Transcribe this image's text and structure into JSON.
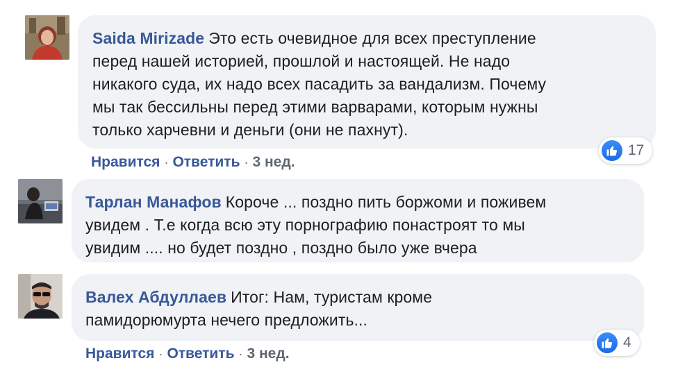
{
  "comments": [
    {
      "author": "Saida Mirizade",
      "lines": [
        "Это есть очевидное для всех преступление",
        "перед нашей историей, прошлой и настоящей. Не надо",
        "никакого суда, их надо всех пасадить за вандализм. Почему",
        "мы так бессильны перед этими варварами, которым нужны",
        "только харчевни и деньги (они не пахнут)."
      ],
      "like_label": "Нравится",
      "reply_label": "Ответить",
      "time": "3 нед.",
      "reaction_count": "17"
    },
    {
      "author": "Тарлан Манафов",
      "lines": [
        "Короче ... поздно пить боржоми и поживем",
        "увидем . Т.е когда всю эту порнографию понастроят то мы",
        "увидим .... но будет поздно , поздно было уже вчера"
      ]
    },
    {
      "author": "Валех Абдуллаев",
      "lines": [
        "Итог: Нам, туристам кроме",
        "памидорюмурта нечего предложить..."
      ],
      "like_label": "Нравится",
      "reply_label": "Ответить",
      "time": "3 нед.",
      "reaction_count": "4"
    }
  ],
  "separator": "·",
  "icons": {
    "reaction": "thumbs-up-icon",
    "like_color": "#1877f2",
    "author_color": "#385898"
  }
}
